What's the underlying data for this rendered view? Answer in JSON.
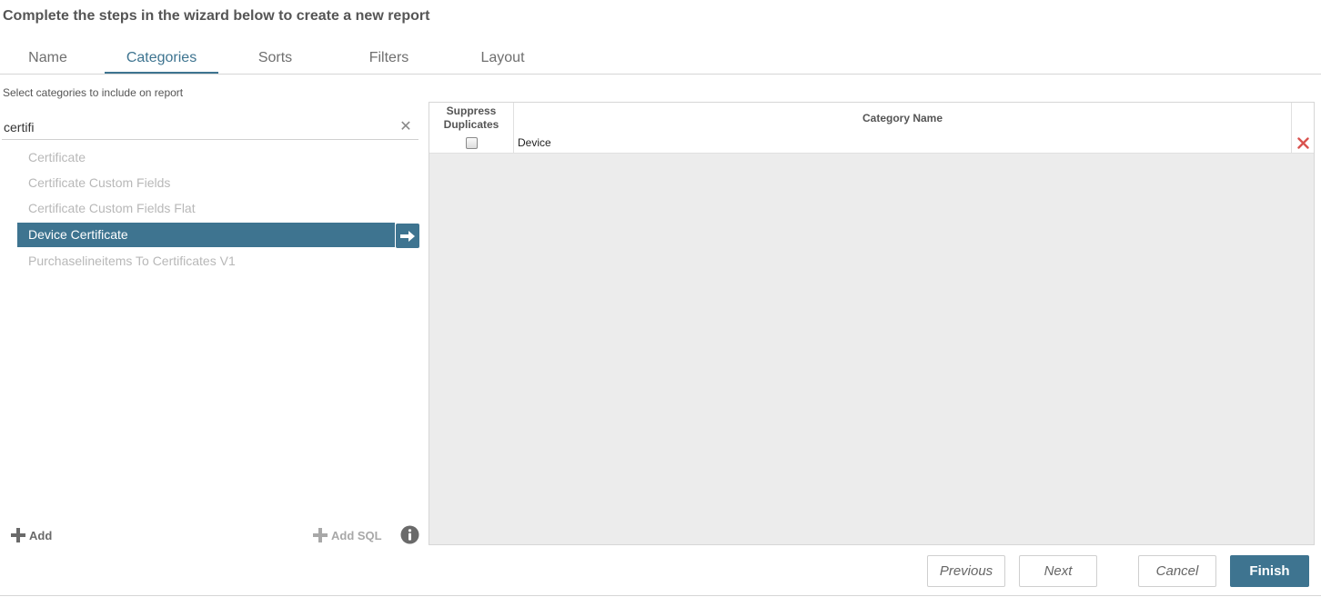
{
  "wizard": {
    "title": "Complete the steps in the wizard below to create a new report"
  },
  "tabs": [
    {
      "label": "Name",
      "active": false
    },
    {
      "label": "Categories",
      "active": true
    },
    {
      "label": "Sorts",
      "active": false
    },
    {
      "label": "Filters",
      "active": false
    },
    {
      "label": "Layout",
      "active": false
    }
  ],
  "left_panel": {
    "instructions": "Select categories to include on report",
    "search": {
      "value": "certifi",
      "placeholder": ""
    },
    "items": [
      {
        "label": "Certificate",
        "selected": false
      },
      {
        "label": "Certificate Custom Fields",
        "selected": false
      },
      {
        "label": "Certificate Custom Fields Flat",
        "selected": false
      },
      {
        "label": "Device Certificate",
        "selected": true
      },
      {
        "label": "Purchaselineitems To Certificates V1",
        "selected": false
      }
    ],
    "add_label": "Add",
    "add_sql_label": "Add SQL"
  },
  "grid": {
    "columns": {
      "suppress_line1": "Suppress",
      "suppress_line2": "Duplicates",
      "category_name": "Category Name"
    },
    "rows": [
      {
        "suppress_duplicates": false,
        "category_name": "Device"
      }
    ]
  },
  "buttons": {
    "previous": "Previous",
    "next": "Next",
    "cancel": "Cancel",
    "finish": "Finish"
  },
  "colors": {
    "accent": "#3e7490",
    "delete": "#d9534f"
  },
  "icons": {
    "search_clear": "close-icon",
    "move_right": "arrow-right-icon",
    "add": "plus-icon",
    "info": "info-icon",
    "delete_row": "delete-x-icon"
  }
}
